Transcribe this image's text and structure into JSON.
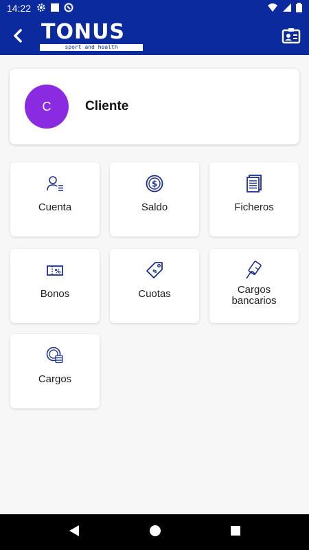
{
  "status_bar": {
    "time": "14:22"
  },
  "app_bar": {
    "logo_text": "TONUS",
    "logo_tagline": "sport and health"
  },
  "profile": {
    "avatar_initial": "C",
    "name": "Cliente",
    "avatar_color": "#8a2be2"
  },
  "menu": {
    "cuenta": "Cuenta",
    "saldo": "Saldo",
    "ficheros": "Ficheros",
    "bonos": "Bonos",
    "cuotas": "Cuotas",
    "cargos_bancarios_1": "Cargos",
    "cargos_bancarios_2": "bancarios",
    "cargos": "Cargos"
  },
  "colors": {
    "brand": "#0a2a9e",
    "icon": "#1a2f8f"
  }
}
